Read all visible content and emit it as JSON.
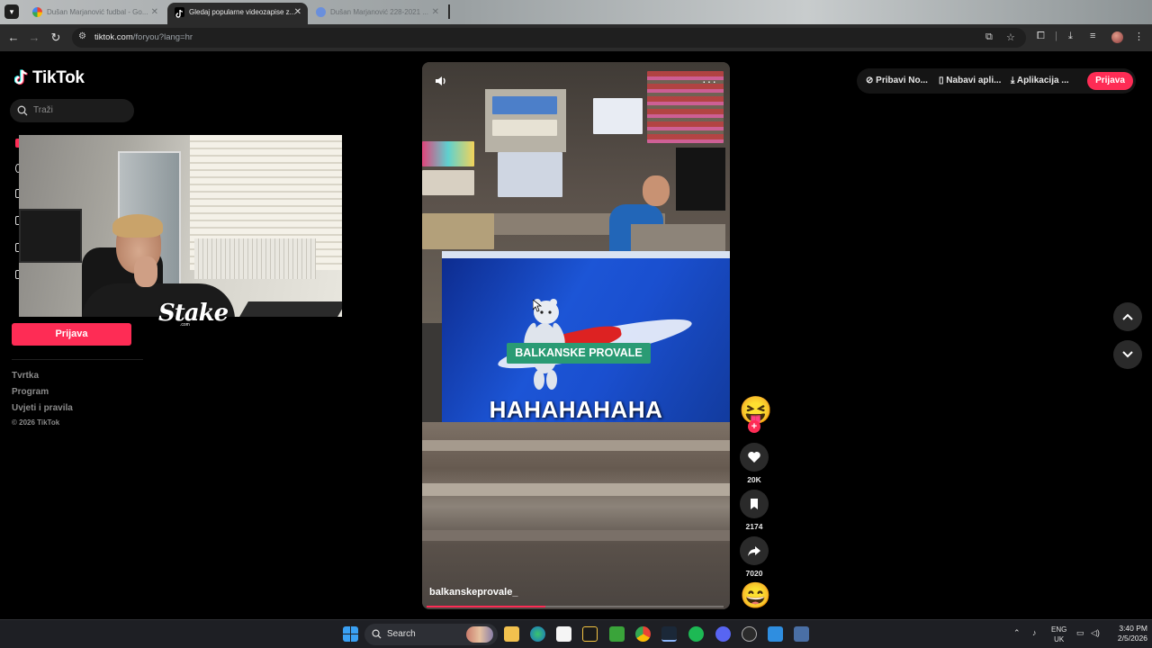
{
  "browser": {
    "tabs": [
      {
        "title": "Dušan Marjanović fudbal - Go...",
        "active": false
      },
      {
        "title": "Gledaj popularne videozapise z...",
        "active": true
      },
      {
        "title": "Dušan Marjanović 228-2021 ...",
        "active": false
      }
    ],
    "url_host": "tiktok.com",
    "url_path": "/foryou?lang=hr"
  },
  "tiktok": {
    "logo_text": "TikTok",
    "search_placeholder": "Traži",
    "login_label": "Prijava",
    "footer_links": [
      "Tvrtka",
      "Program",
      "Uvjeti i pravila"
    ],
    "copyright": "© 2026 TikTok",
    "topbar": {
      "get_coins": "Pribavi No...",
      "get_app": "Nabavi apli...",
      "desktop_app": "Aplikacija ...",
      "login": "Prijava"
    }
  },
  "overlay": {
    "sponsor_logo": "Stake",
    "sponsor_sub": ".com"
  },
  "video": {
    "caption_badge": "BALKANSKE PROVALE",
    "caption_main": "HAHAHAHAHA",
    "author": "balkanskeprovale_",
    "progress": 0.4,
    "likes": "20K",
    "saves": "2174",
    "shares": "7020",
    "avatar_emoji": "😝",
    "music_emoji": "😄"
  },
  "taskbar": {
    "search_label": "Search",
    "lang_top": "ENG",
    "lang_bottom": "UK",
    "time": "3:40 PM",
    "date": "2/5/2026"
  },
  "colors": {
    "accent": "#fe2c55",
    "caption_badge": "#2a9b74",
    "background": "#000000"
  }
}
